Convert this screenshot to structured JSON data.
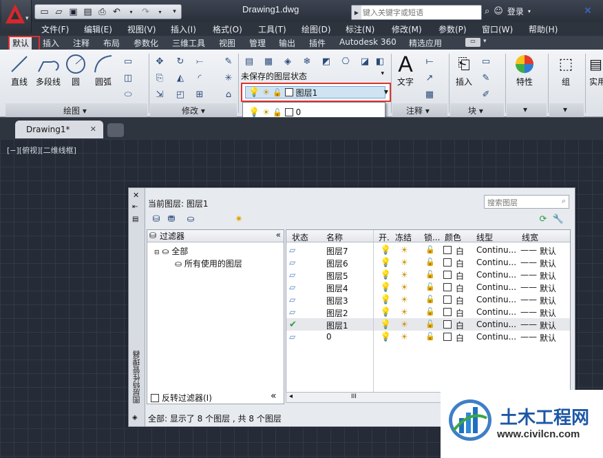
{
  "window": {
    "title": "Drawing1.dwg",
    "search_placeholder": "键入关键字或短语",
    "login_label": "登录"
  },
  "menu": [
    "文件(F)",
    "编辑(E)",
    "视图(V)",
    "插入(I)",
    "格式(O)",
    "工具(T)",
    "绘图(D)",
    "标注(N)",
    "修改(M)",
    "参数(P)",
    "窗口(W)",
    "帮助(H)"
  ],
  "ribbon_tabs": [
    "默认",
    "插入",
    "注释",
    "布局",
    "参数化",
    "三维工具",
    "视图",
    "管理",
    "输出",
    "插件",
    "Autodesk 360",
    "精选应用"
  ],
  "ribbon": {
    "draw_tools": [
      "直线",
      "多段线",
      "圆",
      "圆弧"
    ],
    "panel_draw": "绘图",
    "panel_modify": "修改",
    "panel_annotation": "注释",
    "panel_block": "块",
    "text_tool": "文字",
    "insert_tool": "插入",
    "properties_tool": "特性",
    "group_tool": "组",
    "utilities_tool": "实用",
    "layer_state": "未保存的图层状态",
    "current_layer": "图层1"
  },
  "layer_dropdown": {
    "items": [
      {
        "name": "0",
        "highlighted": false
      },
      {
        "name": "图层1",
        "highlighted": true
      },
      {
        "name": "图层2",
        "highlighted": false
      },
      {
        "name": "图层3",
        "highlighted": false
      },
      {
        "name": "图层4",
        "highlighted": false
      },
      {
        "name": "图层5",
        "highlighted": false
      },
      {
        "name": "图层6",
        "highlighted": true
      },
      {
        "name": "图层7",
        "highlighted": false
      }
    ]
  },
  "doc_tab": {
    "label": "Drawing1*"
  },
  "viewport_label": "[−][俯视][二维线框]",
  "palette": {
    "vertical_title": "图层特性管理器",
    "current_layer": "当前图层: 图层1",
    "search_placeholder": "搜索图层",
    "filter_header": "过滤器",
    "filter_all": "全部",
    "filter_used": "所有使用的图层",
    "reverse_filter": "反转过滤器(I)",
    "columns": [
      "状态",
      "名称",
      "开.",
      "冻结",
      "锁...",
      "颜色",
      "线型",
      "线宽"
    ],
    "rows": [
      {
        "name": "图层7",
        "color": "白",
        "linetype": "Continu...",
        "lineweight": "默认",
        "current": false
      },
      {
        "name": "图层6",
        "color": "白",
        "linetype": "Continu...",
        "lineweight": "默认",
        "current": false
      },
      {
        "name": "图层5",
        "color": "白",
        "linetype": "Continu...",
        "lineweight": "默认",
        "current": false
      },
      {
        "name": "图层4",
        "color": "白",
        "linetype": "Continu...",
        "lineweight": "默认",
        "current": false
      },
      {
        "name": "图层3",
        "color": "白",
        "linetype": "Continu...",
        "lineweight": "默认",
        "current": false
      },
      {
        "name": "图层2",
        "color": "白",
        "linetype": "Continu...",
        "lineweight": "默认",
        "current": false
      },
      {
        "name": "图层1",
        "color": "白",
        "linetype": "Continu...",
        "lineweight": "默认",
        "current": true
      },
      {
        "name": "0",
        "color": "白",
        "linetype": "Continu...",
        "lineweight": "默认",
        "current": false
      }
    ],
    "status": "全部: 显示了 8 个图层 , 共 8 个图层",
    "scroll_marker": "III"
  },
  "watermark": {
    "title": "土木工程网",
    "url": "www.civilcn.com"
  }
}
